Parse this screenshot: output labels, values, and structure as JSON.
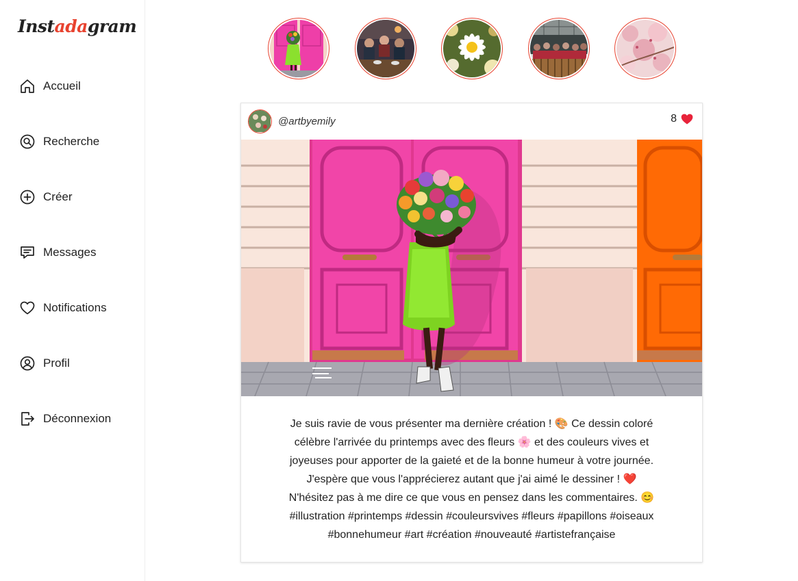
{
  "app": {
    "logo_part1": "Inst",
    "logo_part2": "ada",
    "logo_part3": "gram",
    "accent_color": "#e8422f"
  },
  "sidebar": {
    "items": [
      {
        "label": "Accueil",
        "icon": "home-icon"
      },
      {
        "label": "Recherche",
        "icon": "search-icon"
      },
      {
        "label": "Créer",
        "icon": "plus-circle-icon"
      },
      {
        "label": "Messages",
        "icon": "message-icon"
      },
      {
        "label": "Notifications",
        "icon": "heart-icon"
      },
      {
        "label": "Profil",
        "icon": "user-icon"
      },
      {
        "label": "Déconnexion",
        "icon": "logout-icon"
      }
    ]
  },
  "stories": [
    {
      "subject": "pink door illustration"
    },
    {
      "subject": "group at table"
    },
    {
      "subject": "daisy flowers"
    },
    {
      "subject": "group photo"
    },
    {
      "subject": "cherry blossom"
    }
  ],
  "post": {
    "username": "@artbyemily",
    "likes": "8",
    "heart_color": "#e8233a",
    "caption_lines": [
      "Je suis ravie de vous présenter ma dernière création ! 🎨 Ce dessin coloré",
      "célèbre l'arrivée du printemps avec des fleurs 🌸 et des couleurs vives et",
      "joyeuses pour apporter de la gaieté et de la bonne humeur à votre journée.",
      "J'espère que vous l'apprécierez autant que j'ai aimé le dessiner ! ❤️",
      "N'hésitez pas à me dire ce que vous en pensez dans les commentaires. 😊",
      "#illustration #printemps #dessin #couleursvives #fleurs #papillons #oiseaux",
      "#bonnehumeur #art #création #nouveauté #artistefrançaise"
    ]
  }
}
